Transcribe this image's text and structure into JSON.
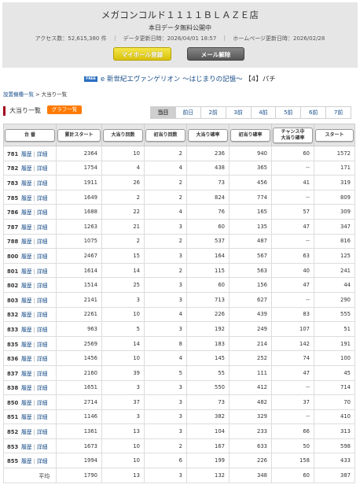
{
  "header": {
    "store_name": "メガコンコルド１１１１ＢＬＡＺＥ店",
    "subtitle": "本日データ無料公開中",
    "stats": "アクセス数：52,615,380 件　｜　データ更新日時：2026/04/01 18:57　｜　ホームページ更新日時：2026/02/28",
    "mypage_button": "マイホール登録",
    "mail_button": "メール解除"
  },
  "machine": {
    "free_badge": "FREE",
    "title": "e 新世紀エヴァンゲリオン ～はじまりの記憶～",
    "paren": "【4】パチ"
  },
  "breadcrumb": {
    "link": "設置機種一覧",
    "sep": " > ",
    "current": "大当り一覧"
  },
  "section": {
    "title": "大当り一覧",
    "graph_button": "グラフ一覧"
  },
  "tabs": [
    "当日",
    "前日",
    "2前",
    "3前",
    "4前",
    "5前",
    "6前",
    "7前"
  ],
  "table": {
    "headers": [
      "台 番",
      "累計スタート",
      "大当り回数",
      "初当り回数",
      "大当り確率",
      "初当り確率",
      "チャンス中\n大当り確率",
      "スタート"
    ],
    "history_label": "履歴",
    "detail_label": "詳細",
    "rows": [
      {
        "id": "781",
        "total": "2364",
        "bb": "10",
        "first": "2",
        "prob": "236",
        "fprob": "940",
        "chance": "60",
        "start": "1572"
      },
      {
        "id": "782",
        "total": "1754",
        "bb": "4",
        "first": "4",
        "prob": "438",
        "fprob": "365",
        "chance": "--",
        "start": "171"
      },
      {
        "id": "783",
        "total": "1911",
        "bb": "26",
        "first": "2",
        "prob": "73",
        "fprob": "456",
        "chance": "41",
        "start": "319"
      },
      {
        "id": "785",
        "total": "1649",
        "bb": "2",
        "first": "2",
        "prob": "824",
        "fprob": "774",
        "chance": "--",
        "start": "809"
      },
      {
        "id": "786",
        "total": "1688",
        "bb": "22",
        "first": "4",
        "prob": "76",
        "fprob": "165",
        "chance": "57",
        "start": "309"
      },
      {
        "id": "787",
        "total": "1263",
        "bb": "21",
        "first": "3",
        "prob": "60",
        "fprob": "135",
        "chance": "47",
        "start": "347"
      },
      {
        "id": "788",
        "total": "1075",
        "bb": "2",
        "first": "2",
        "prob": "537",
        "fprob": "487",
        "chance": "--",
        "start": "816"
      },
      {
        "id": "800",
        "total": "2467",
        "bb": "15",
        "first": "3",
        "prob": "164",
        "fprob": "567",
        "chance": "63",
        "start": "125"
      },
      {
        "id": "801",
        "total": "1614",
        "bb": "14",
        "first": "2",
        "prob": "115",
        "fprob": "563",
        "chance": "40",
        "start": "241"
      },
      {
        "id": "802",
        "total": "1514",
        "bb": "25",
        "first": "3",
        "prob": "60",
        "fprob": "156",
        "chance": "47",
        "start": "44"
      },
      {
        "id": "803",
        "total": "2141",
        "bb": "3",
        "first": "3",
        "prob": "713",
        "fprob": "627",
        "chance": "--",
        "start": "290"
      },
      {
        "id": "832",
        "total": "2261",
        "bb": "10",
        "first": "4",
        "prob": "226",
        "fprob": "439",
        "chance": "83",
        "start": "555"
      },
      {
        "id": "833",
        "total": "963",
        "bb": "5",
        "first": "3",
        "prob": "192",
        "fprob": "249",
        "chance": "107",
        "start": "51"
      },
      {
        "id": "835",
        "total": "2569",
        "bb": "14",
        "first": "8",
        "prob": "183",
        "fprob": "214",
        "chance": "142",
        "start": "191"
      },
      {
        "id": "836",
        "total": "1456",
        "bb": "10",
        "first": "4",
        "prob": "145",
        "fprob": "252",
        "chance": "74",
        "start": "100"
      },
      {
        "id": "837",
        "total": "2160",
        "bb": "39",
        "first": "5",
        "prob": "55",
        "fprob": "111",
        "chance": "47",
        "start": "45"
      },
      {
        "id": "838",
        "total": "1651",
        "bb": "3",
        "first": "3",
        "prob": "550",
        "fprob": "412",
        "chance": "--",
        "start": "714"
      },
      {
        "id": "850",
        "total": "2714",
        "bb": "37",
        "first": "3",
        "prob": "73",
        "fprob": "482",
        "chance": "37",
        "start": "70"
      },
      {
        "id": "851",
        "total": "1146",
        "bb": "3",
        "first": "3",
        "prob": "382",
        "fprob": "329",
        "chance": "--",
        "start": "410"
      },
      {
        "id": "852",
        "total": "1361",
        "bb": "13",
        "first": "3",
        "prob": "104",
        "fprob": "233",
        "chance": "66",
        "start": "313"
      },
      {
        "id": "853",
        "total": "1673",
        "bb": "10",
        "first": "2",
        "prob": "167",
        "fprob": "633",
        "chance": "50",
        "start": "598"
      },
      {
        "id": "855",
        "total": "1994",
        "bb": "10",
        "first": "6",
        "prob": "199",
        "fprob": "226",
        "chance": "158",
        "start": "433"
      }
    ],
    "average": {
      "label": "平均",
      "total": "1790",
      "bb": "13",
      "first": "3",
      "prob": "132",
      "fprob": "348",
      "chance": "60",
      "start": "387"
    }
  }
}
